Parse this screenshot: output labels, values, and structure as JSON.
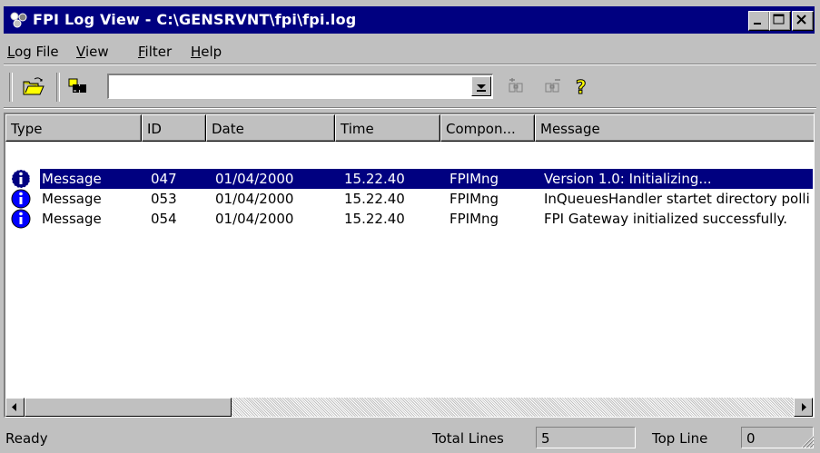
{
  "window": {
    "title": "FPI Log View - C:\\GENSRVNT\\fpi\\fpi.log"
  },
  "menu": [
    {
      "label": "Log File",
      "underline": "L",
      "rest": "og File"
    },
    {
      "label": "View",
      "underline": "V",
      "rest": "iew"
    },
    {
      "label": "Filter",
      "underline": "F",
      "rest": "ilter"
    },
    {
      "label": "Help",
      "underline": "H",
      "rest": "elp"
    }
  ],
  "toolbar": {
    "search_value": "",
    "icons": [
      "open-folder-icon",
      "find-icon",
      "find-next-icon",
      "find-previous-icon",
      "help-icon"
    ]
  },
  "list": {
    "columns": [
      "Type",
      "ID",
      "Date",
      "Time",
      "Compon...",
      "Message"
    ],
    "rows": [
      {
        "type": "Message",
        "id": "047",
        "date": "01/04/2000",
        "time": "15.22.40",
        "component": "FPIMng",
        "message": "Version 1.0: Initializing...",
        "selected": true
      },
      {
        "type": "Message",
        "id": "053",
        "date": "01/04/2000",
        "time": "15.22.40",
        "component": "FPIMng",
        "message": "InQueuesHandler startet directory polli",
        "selected": false
      },
      {
        "type": "Message",
        "id": "054",
        "date": "01/04/2000",
        "time": "15.22.40",
        "component": "FPIMng",
        "message": "FPI Gateway initialized successfully.",
        "selected": false
      }
    ]
  },
  "status": {
    "text": "Ready",
    "total_lines_label": "Total Lines",
    "total_lines_value": "5",
    "top_line_label": "Top Line",
    "top_line_value": "0"
  },
  "colors": {
    "title_bar": "#000080",
    "face": "#c0c0c0",
    "selection": "#000080",
    "info_icon": "#0000ff"
  }
}
